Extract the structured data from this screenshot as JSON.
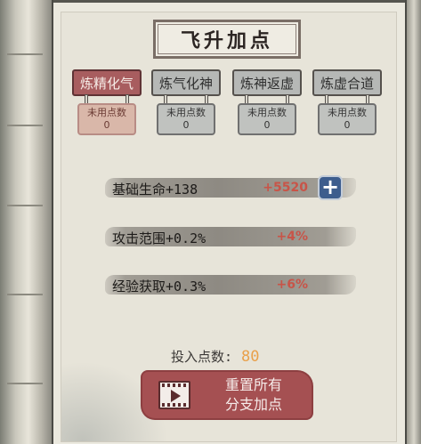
{
  "title": "飞升加点",
  "realms": [
    {
      "name": "炼精化气",
      "unused_label": "未用点数",
      "unused_value": "0",
      "active": true
    },
    {
      "name": "炼气化神",
      "unused_label": "未用点数",
      "unused_value": "0",
      "active": false
    },
    {
      "name": "炼神返虚",
      "unused_label": "未用点数",
      "unused_value": "0",
      "active": false
    },
    {
      "name": "炼虚合道",
      "unused_label": "未用点数",
      "unused_value": "0",
      "active": false
    }
  ],
  "stats": [
    {
      "label": "基础生命+138",
      "bonus": "+5520",
      "has_plus": true
    },
    {
      "label": "攻击范围+0.2%",
      "bonus": "+4%",
      "has_plus": false
    },
    {
      "label": "经验获取+0.3%",
      "bonus": "+6%",
      "has_plus": false
    }
  ],
  "plus_symbol": "+",
  "points": {
    "label": "投入点数:",
    "value": "80"
  },
  "reset_button": {
    "line1": "重置所有",
    "line2": "分支加点",
    "icon": "video-play-icon"
  },
  "colors": {
    "active_tab": "#a85d5f",
    "bonus_text": "#c85448",
    "points_value": "#e9a04a",
    "reset_button": "#a55052",
    "plus_button": "#3d5d8d"
  }
}
